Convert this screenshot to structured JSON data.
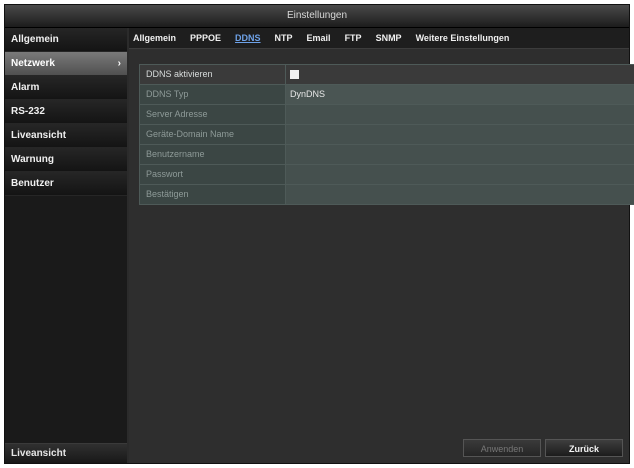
{
  "window": {
    "title": "Einstellungen"
  },
  "sidebar": {
    "items": [
      {
        "label": "Allgemein",
        "active": false
      },
      {
        "label": "Netzwerk",
        "active": true
      },
      {
        "label": "Alarm",
        "active": false
      },
      {
        "label": "RS-232",
        "active": false
      },
      {
        "label": "Liveansicht",
        "active": false
      },
      {
        "label": "Warnung",
        "active": false
      },
      {
        "label": "Benutzer",
        "active": false
      }
    ],
    "bottom_label": "Liveansicht"
  },
  "tabs": [
    {
      "label": "Allgemein",
      "active": false
    },
    {
      "label": "PPPOE",
      "active": false
    },
    {
      "label": "DDNS",
      "active": true
    },
    {
      "label": "NTP",
      "active": false
    },
    {
      "label": "Email",
      "active": false
    },
    {
      "label": "FTP",
      "active": false
    },
    {
      "label": "SNMP",
      "active": false
    },
    {
      "label": "Weitere Einstellungen",
      "active": false
    }
  ],
  "form": {
    "enable_label": "DDNS aktivieren",
    "enable_checked": false,
    "fields": [
      {
        "label": "DDNS Typ",
        "value": "DynDNS"
      },
      {
        "label": "Server Adresse",
        "value": ""
      },
      {
        "label": "Geräte-Domain Name",
        "value": ""
      },
      {
        "label": "Benutzername",
        "value": ""
      },
      {
        "label": "Passwort",
        "value": ""
      },
      {
        "label": "Bestätigen",
        "value": ""
      }
    ]
  },
  "buttons": {
    "apply": "Anwenden",
    "back": "Zurück"
  }
}
